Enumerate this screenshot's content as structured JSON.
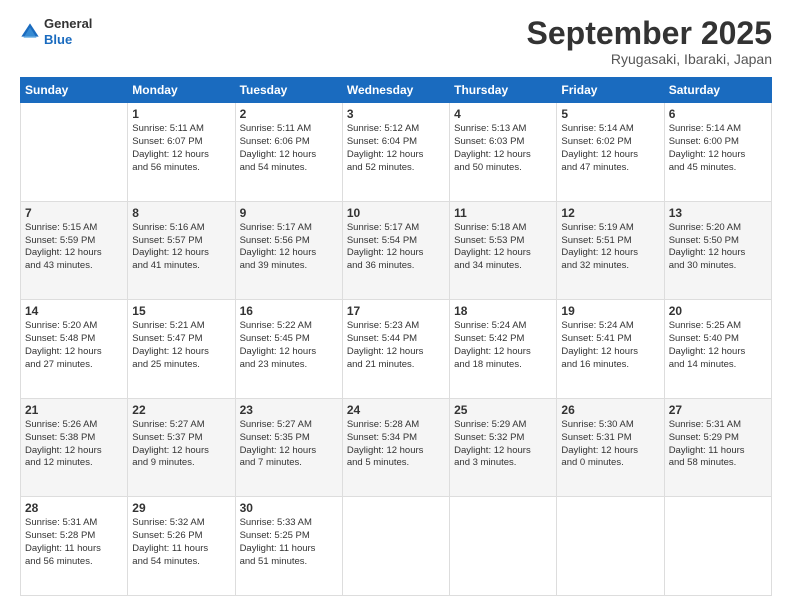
{
  "logo": {
    "general": "General",
    "blue": "Blue"
  },
  "header": {
    "month_year": "September 2025",
    "location": "Ryugasaki, Ibaraki, Japan"
  },
  "days_of_week": [
    "Sunday",
    "Monday",
    "Tuesday",
    "Wednesday",
    "Thursday",
    "Friday",
    "Saturday"
  ],
  "weeks": [
    [
      {
        "day": "",
        "content": ""
      },
      {
        "day": "1",
        "content": "Sunrise: 5:11 AM\nSunset: 6:07 PM\nDaylight: 12 hours\nand 56 minutes."
      },
      {
        "day": "2",
        "content": "Sunrise: 5:11 AM\nSunset: 6:06 PM\nDaylight: 12 hours\nand 54 minutes."
      },
      {
        "day": "3",
        "content": "Sunrise: 5:12 AM\nSunset: 6:04 PM\nDaylight: 12 hours\nand 52 minutes."
      },
      {
        "day": "4",
        "content": "Sunrise: 5:13 AM\nSunset: 6:03 PM\nDaylight: 12 hours\nand 50 minutes."
      },
      {
        "day": "5",
        "content": "Sunrise: 5:14 AM\nSunset: 6:02 PM\nDaylight: 12 hours\nand 47 minutes."
      },
      {
        "day": "6",
        "content": "Sunrise: 5:14 AM\nSunset: 6:00 PM\nDaylight: 12 hours\nand 45 minutes."
      }
    ],
    [
      {
        "day": "7",
        "content": "Sunrise: 5:15 AM\nSunset: 5:59 PM\nDaylight: 12 hours\nand 43 minutes."
      },
      {
        "day": "8",
        "content": "Sunrise: 5:16 AM\nSunset: 5:57 PM\nDaylight: 12 hours\nand 41 minutes."
      },
      {
        "day": "9",
        "content": "Sunrise: 5:17 AM\nSunset: 5:56 PM\nDaylight: 12 hours\nand 39 minutes."
      },
      {
        "day": "10",
        "content": "Sunrise: 5:17 AM\nSunset: 5:54 PM\nDaylight: 12 hours\nand 36 minutes."
      },
      {
        "day": "11",
        "content": "Sunrise: 5:18 AM\nSunset: 5:53 PM\nDaylight: 12 hours\nand 34 minutes."
      },
      {
        "day": "12",
        "content": "Sunrise: 5:19 AM\nSunset: 5:51 PM\nDaylight: 12 hours\nand 32 minutes."
      },
      {
        "day": "13",
        "content": "Sunrise: 5:20 AM\nSunset: 5:50 PM\nDaylight: 12 hours\nand 30 minutes."
      }
    ],
    [
      {
        "day": "14",
        "content": "Sunrise: 5:20 AM\nSunset: 5:48 PM\nDaylight: 12 hours\nand 27 minutes."
      },
      {
        "day": "15",
        "content": "Sunrise: 5:21 AM\nSunset: 5:47 PM\nDaylight: 12 hours\nand 25 minutes."
      },
      {
        "day": "16",
        "content": "Sunrise: 5:22 AM\nSunset: 5:45 PM\nDaylight: 12 hours\nand 23 minutes."
      },
      {
        "day": "17",
        "content": "Sunrise: 5:23 AM\nSunset: 5:44 PM\nDaylight: 12 hours\nand 21 minutes."
      },
      {
        "day": "18",
        "content": "Sunrise: 5:24 AM\nSunset: 5:42 PM\nDaylight: 12 hours\nand 18 minutes."
      },
      {
        "day": "19",
        "content": "Sunrise: 5:24 AM\nSunset: 5:41 PM\nDaylight: 12 hours\nand 16 minutes."
      },
      {
        "day": "20",
        "content": "Sunrise: 5:25 AM\nSunset: 5:40 PM\nDaylight: 12 hours\nand 14 minutes."
      }
    ],
    [
      {
        "day": "21",
        "content": "Sunrise: 5:26 AM\nSunset: 5:38 PM\nDaylight: 12 hours\nand 12 minutes."
      },
      {
        "day": "22",
        "content": "Sunrise: 5:27 AM\nSunset: 5:37 PM\nDaylight: 12 hours\nand 9 minutes."
      },
      {
        "day": "23",
        "content": "Sunrise: 5:27 AM\nSunset: 5:35 PM\nDaylight: 12 hours\nand 7 minutes."
      },
      {
        "day": "24",
        "content": "Sunrise: 5:28 AM\nSunset: 5:34 PM\nDaylight: 12 hours\nand 5 minutes."
      },
      {
        "day": "25",
        "content": "Sunrise: 5:29 AM\nSunset: 5:32 PM\nDaylight: 12 hours\nand 3 minutes."
      },
      {
        "day": "26",
        "content": "Sunrise: 5:30 AM\nSunset: 5:31 PM\nDaylight: 12 hours\nand 0 minutes."
      },
      {
        "day": "27",
        "content": "Sunrise: 5:31 AM\nSunset: 5:29 PM\nDaylight: 11 hours\nand 58 minutes."
      }
    ],
    [
      {
        "day": "28",
        "content": "Sunrise: 5:31 AM\nSunset: 5:28 PM\nDaylight: 11 hours\nand 56 minutes."
      },
      {
        "day": "29",
        "content": "Sunrise: 5:32 AM\nSunset: 5:26 PM\nDaylight: 11 hours\nand 54 minutes."
      },
      {
        "day": "30",
        "content": "Sunrise: 5:33 AM\nSunset: 5:25 PM\nDaylight: 11 hours\nand 51 minutes."
      },
      {
        "day": "",
        "content": ""
      },
      {
        "day": "",
        "content": ""
      },
      {
        "day": "",
        "content": ""
      },
      {
        "day": "",
        "content": ""
      }
    ]
  ]
}
